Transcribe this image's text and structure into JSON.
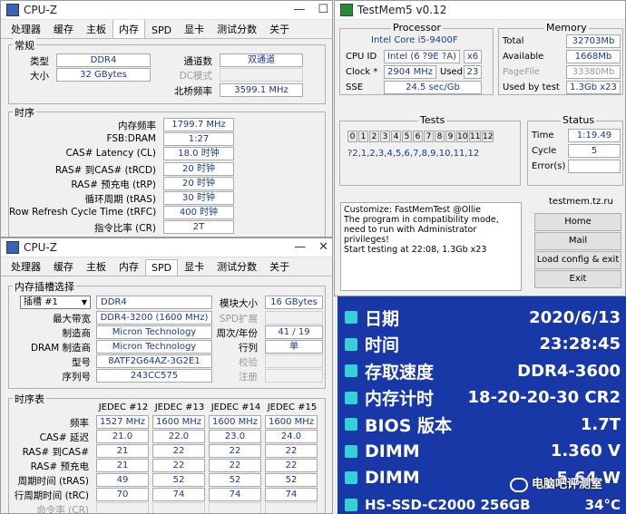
{
  "cpuz1": {
    "title": "CPU-Z",
    "tabs": [
      "处理器",
      "缓存",
      "主板",
      "内存",
      "SPD",
      "显卡",
      "测试分数",
      "关于"
    ],
    "active_tab": 3,
    "general": {
      "label": "常规",
      "type_label": "类型",
      "type_value": "DDR4",
      "size_label": "大小",
      "size_value": "32 GBytes",
      "channels_label": "通道数",
      "channels_value": "双通道",
      "dc_label": "DC模式",
      "nb_label": "北桥频率",
      "nb_value": "3599.1 MHz"
    },
    "timing": {
      "label": "时序",
      "rows": [
        {
          "label": "内存频率",
          "value": "1799.7 MHz"
        },
        {
          "label": "FSB:DRAM",
          "value": "1:27"
        },
        {
          "label": "CAS# Latency (CL)",
          "value": "18.0 时钟"
        },
        {
          "label": "RAS# 到CAS# (tRCD)",
          "value": "20 时钟"
        },
        {
          "label": "RAS# 预充电 (tRP)",
          "value": "20 时钟"
        },
        {
          "label": "循环周期 (tRAS)",
          "value": "30 时钟"
        },
        {
          "label": "Row Refresh Cycle Time (tRFC)",
          "value": "400 时钟"
        },
        {
          "label": "指令比率 (CR)",
          "value": "2T"
        }
      ]
    }
  },
  "cpuz2": {
    "title": "CPU-Z",
    "tabs": [
      "处理器",
      "缓存",
      "主板",
      "内存",
      "SPD",
      "显卡",
      "测试分数",
      "关于"
    ],
    "active_tab": 4,
    "slot": {
      "label": "内存插槽选择",
      "slot_value": "插槽 #1",
      "module_type": "DDR4",
      "module_size_label": "模块大小",
      "module_size_value": "16 GBytes",
      "max_bw_label": "最大带宽",
      "max_bw_value": "DDR4-3200 (1600 MHz)",
      "spd_ext_label": "SPD扩展",
      "mfr_label": "制造商",
      "mfr_value": "Micron Technology",
      "week_label": "周次/年份",
      "week_value": "41 / 19",
      "dram_mfr_label": "DRAM 制造商",
      "dram_mfr_value": "Micron Technology",
      "rank_label": "行列",
      "rank_value": "单",
      "model_label": "型号",
      "model_value": "8ATF2G64AZ-3G2E1",
      "check_label": "校验",
      "serial_label": "序列号",
      "serial_value": "243CC575",
      "reg_label": "注册"
    },
    "timing_table": {
      "label": "时序表",
      "columns": [
        "JEDEC #12",
        "JEDEC #13",
        "JEDEC #14",
        "JEDEC #15"
      ],
      "rows": [
        {
          "label": "频率",
          "values": [
            "1527 MHz",
            "1600 MHz",
            "1600 MHz",
            "1600 MHz"
          ]
        },
        {
          "label": "CAS# 延迟",
          "values": [
            "21.0",
            "22.0",
            "23.0",
            "24.0"
          ]
        },
        {
          "label": "RAS# 到CAS#",
          "values": [
            "21",
            "22",
            "22",
            "22"
          ]
        },
        {
          "label": "RAS# 预充电",
          "values": [
            "21",
            "22",
            "22",
            "22"
          ]
        },
        {
          "label": "周期时间 (tRAS)",
          "values": [
            "49",
            "52",
            "52",
            "52"
          ]
        },
        {
          "label": "行周期时间 (tRC)",
          "values": [
            "70",
            "74",
            "74",
            "74"
          ]
        },
        {
          "label": "命令率 (CR)",
          "values": [
            "",
            "",
            "",
            ""
          ]
        }
      ]
    }
  },
  "testmem": {
    "title": "TestMem5 v0.12",
    "processor_label": "Processor",
    "processor_name": "Intel Core i5-9400F",
    "cpu_id_label": "CPU ID",
    "cpu_id_value": "Intel (6 ?9E ?A)",
    "cpu_threads": "x6",
    "clock_label": "Clock *",
    "clock_value": "2904 MHz",
    "used_label": "Used",
    "used_value": "23",
    "sse_label": "SSE",
    "sse_value": "24.5 sec/Gb",
    "memory_label": "Memory",
    "total_label": "Total",
    "total_value": "32703Mb",
    "avail_label": "Available",
    "avail_value": "1668Mb",
    "pagefile_label": "PageFile",
    "pagefile_value": "33380Mb",
    "usedtest_label": "Used by test",
    "usedtest_value": "1.3Gb x23",
    "tests_label": "Tests",
    "test_numbers": [
      "0",
      "1",
      "2",
      "3",
      "4",
      "5",
      "6",
      "7",
      "8",
      "9",
      "10",
      "11",
      "12"
    ],
    "test_sequence": "?2,1,2,3,4,5,6,7,8,9,10,11,12",
    "status_label": "Status",
    "time_label": "Time",
    "time_value": "1:19.49",
    "cycle_label": "Cycle",
    "cycle_value": "5",
    "errors_label": "Error(s)",
    "errors_value": "",
    "log": [
      "Customize: FastMemTest @Ollie",
      "The program in compatibility mode,",
      "need to run with Administrator privileges!",
      "Start testing at 22:08, 1.3Gb x23"
    ],
    "site": "testmem.tz.ru",
    "buttons": [
      "Home",
      "Mail",
      "Load config & exit",
      "Exit"
    ]
  },
  "monitor": {
    "rows": [
      {
        "label": "日期",
        "value": "2020/6/13",
        "icon": "calendar-icon"
      },
      {
        "label": "时间",
        "value": "23:28:45",
        "icon": "clock-icon"
      },
      {
        "label": "存取速度",
        "value": "DDR4-3600",
        "icon": "memory-icon"
      },
      {
        "label": "内存计时",
        "value": "18-20-20-30 CR2",
        "icon": "memory-icon"
      },
      {
        "label": "BIOS 版本",
        "value": "1.7T",
        "icon": "chip-icon"
      },
      {
        "label": "DIMM",
        "value": "1.360 V",
        "icon": "memory-icon"
      },
      {
        "label": "DIMM",
        "value": "5.64 W",
        "icon": "memory-icon"
      },
      {
        "label": "HS-SSD-C2000 256GB",
        "value": "34°C",
        "icon": "disk-icon"
      }
    ],
    "watermark": "电脑吧评测室",
    "colors": {
      "background": "#1838a8",
      "label": "#ffffff",
      "value": "#ffffff",
      "accent": "#36d1d6"
    }
  }
}
